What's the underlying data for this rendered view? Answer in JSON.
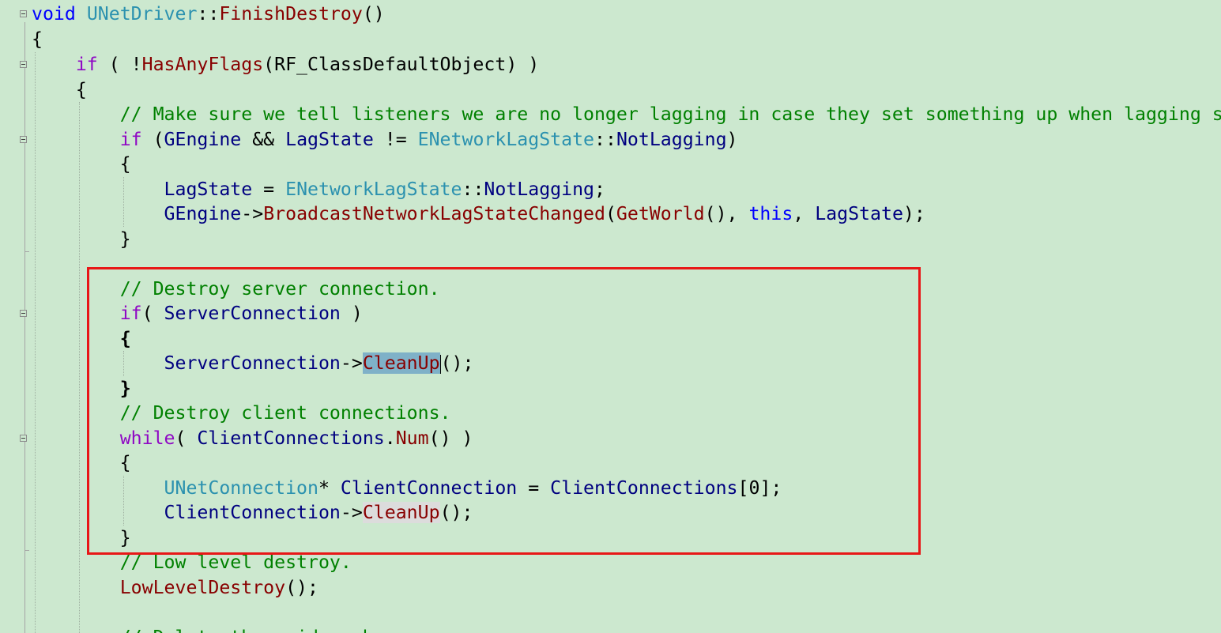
{
  "editor": {
    "background": "#cce8cf",
    "lines": [
      {
        "tokens": [
          {
            "t": "void",
            "c": "kw"
          },
          {
            "t": " "
          },
          {
            "t": "UNetDriver",
            "c": "type"
          },
          {
            "t": "::"
          },
          {
            "t": "FinishDestroy",
            "c": "fn"
          },
          {
            "t": "()"
          }
        ]
      },
      {
        "tokens": [
          {
            "t": "{"
          }
        ]
      },
      {
        "tokens": [
          {
            "t": "    "
          },
          {
            "t": "if",
            "c": "ctl"
          },
          {
            "t": " ( !"
          },
          {
            "t": "HasAnyFlags",
            "c": "fn"
          },
          {
            "t": "("
          },
          {
            "t": "RF_ClassDefaultObject",
            "c": "ident"
          },
          {
            "t": ") )"
          }
        ]
      },
      {
        "tokens": [
          {
            "t": "    {"
          }
        ]
      },
      {
        "tokens": [
          {
            "t": "        "
          },
          {
            "t": "// Make sure we tell listeners we are no longer lagging in case they set something up when lagging started.",
            "c": "cm"
          }
        ]
      },
      {
        "tokens": [
          {
            "t": "        "
          },
          {
            "t": "if",
            "c": "ctl"
          },
          {
            "t": " ("
          },
          {
            "t": "GEngine",
            "c": "var"
          },
          {
            "t": " && "
          },
          {
            "t": "LagState",
            "c": "var"
          },
          {
            "t": " != "
          },
          {
            "t": "ENetworkLagState",
            "c": "type"
          },
          {
            "t": "::"
          },
          {
            "t": "NotLagging",
            "c": "var"
          },
          {
            "t": ")"
          }
        ]
      },
      {
        "tokens": [
          {
            "t": "        {"
          }
        ]
      },
      {
        "tokens": [
          {
            "t": "            "
          },
          {
            "t": "LagState",
            "c": "var"
          },
          {
            "t": " = "
          },
          {
            "t": "ENetworkLagState",
            "c": "type"
          },
          {
            "t": "::"
          },
          {
            "t": "NotLagging",
            "c": "var"
          },
          {
            "t": ";"
          }
        ]
      },
      {
        "tokens": [
          {
            "t": "            "
          },
          {
            "t": "GEngine",
            "c": "var"
          },
          {
            "t": "->"
          },
          {
            "t": "BroadcastNetworkLagStateChanged",
            "c": "fn"
          },
          {
            "t": "("
          },
          {
            "t": "GetWorld",
            "c": "fn"
          },
          {
            "t": "(), "
          },
          {
            "t": "this",
            "c": "kw"
          },
          {
            "t": ", "
          },
          {
            "t": "LagState",
            "c": "var"
          },
          {
            "t": ");"
          }
        ]
      },
      {
        "tokens": [
          {
            "t": "        }"
          }
        ]
      },
      {
        "tokens": [
          {
            "t": ""
          }
        ]
      },
      {
        "tokens": [
          {
            "t": "        "
          },
          {
            "t": "// Destroy server connection.",
            "c": "cm"
          }
        ]
      },
      {
        "tokens": [
          {
            "t": "        "
          },
          {
            "t": "if",
            "c": "ctl"
          },
          {
            "t": "( "
          },
          {
            "t": "ServerConnection",
            "c": "var"
          },
          {
            "t": " )"
          }
        ]
      },
      {
        "tokens": [
          {
            "t": "        "
          },
          {
            "t": "{",
            "c": "bold"
          }
        ]
      },
      {
        "tokens": [
          {
            "t": "            "
          },
          {
            "t": "ServerConnection",
            "c": "var"
          },
          {
            "t": "->"
          },
          {
            "t": "CleanUp",
            "c": "fn sel"
          },
          {
            "caret": true
          },
          {
            "t": "();"
          }
        ]
      },
      {
        "tokens": [
          {
            "t": "        "
          },
          {
            "t": "}",
            "c": "bold"
          }
        ]
      },
      {
        "tokens": [
          {
            "t": "        "
          },
          {
            "t": "// Destroy client connections.",
            "c": "cm"
          }
        ]
      },
      {
        "tokens": [
          {
            "t": "        "
          },
          {
            "t": "while",
            "c": "ctl"
          },
          {
            "t": "( "
          },
          {
            "t": "ClientConnections",
            "c": "var"
          },
          {
            "t": "."
          },
          {
            "t": "Num",
            "c": "fn"
          },
          {
            "t": "() )"
          }
        ]
      },
      {
        "tokens": [
          {
            "t": "        {"
          }
        ]
      },
      {
        "tokens": [
          {
            "t": "            "
          },
          {
            "t": "UNetConnection",
            "c": "type"
          },
          {
            "t": "* "
          },
          {
            "t": "ClientConnection",
            "c": "var"
          },
          {
            "t": " = "
          },
          {
            "t": "ClientConnections",
            "c": "var"
          },
          {
            "t": "["
          },
          {
            "t": "0",
            "c": "num"
          },
          {
            "t": "];"
          }
        ]
      },
      {
        "tokens": [
          {
            "t": "            "
          },
          {
            "t": "ClientConnection",
            "c": "var"
          },
          {
            "t": "->"
          },
          {
            "t": "CleanUp",
            "c": "fn hl"
          },
          {
            "t": "();"
          }
        ]
      },
      {
        "tokens": [
          {
            "t": "        }"
          }
        ]
      },
      {
        "tokens": [
          {
            "t": "        "
          },
          {
            "t": "// Low level destroy.",
            "c": "cm"
          }
        ]
      },
      {
        "tokens": [
          {
            "t": "        "
          },
          {
            "t": "LowLevelDestroy",
            "c": "fn"
          },
          {
            "t": "();"
          }
        ]
      },
      {
        "tokens": [
          {
            "t": ""
          }
        ]
      },
      {
        "tokens": [
          {
            "t": "        "
          },
          {
            "t": "// Delete the guid cache",
            "c": "cm"
          }
        ]
      }
    ]
  },
  "highlight_box": {
    "color": "#e81717"
  },
  "colors": {
    "keyword": "#0000ff",
    "control": "#8f08c4",
    "type": "#2b91af",
    "function": "#880000",
    "variable": "#000080",
    "comment": "#008000",
    "selection": "#7fb1c8"
  }
}
